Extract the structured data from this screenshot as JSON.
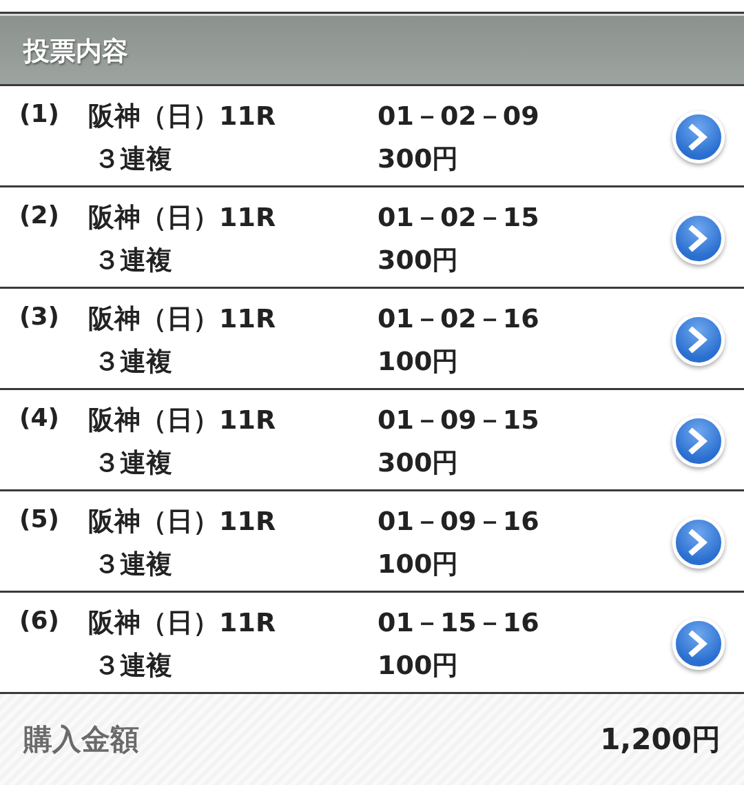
{
  "header": {
    "title": "投票内容"
  },
  "bets": [
    {
      "number": "(1)",
      "race": "阪神（日）11R",
      "type": "３連複",
      "combination": "01－02－09",
      "amount": "300円"
    },
    {
      "number": "(2)",
      "race": "阪神（日）11R",
      "type": "３連複",
      "combination": "01－02－15",
      "amount": "300円"
    },
    {
      "number": "(3)",
      "race": "阪神（日）11R",
      "type": "３連複",
      "combination": "01－02－16",
      "amount": "100円"
    },
    {
      "number": "(4)",
      "race": "阪神（日）11R",
      "type": "３連複",
      "combination": "01－09－15",
      "amount": "300円"
    },
    {
      "number": "(5)",
      "race": "阪神（日）11R",
      "type": "３連複",
      "combination": "01－09－16",
      "amount": "100円"
    },
    {
      "number": "(6)",
      "race": "阪神（日）11R",
      "type": "３連複",
      "combination": "01－15－16",
      "amount": "100円"
    }
  ],
  "footer": {
    "label": "購入金額",
    "total": "1,200円"
  }
}
